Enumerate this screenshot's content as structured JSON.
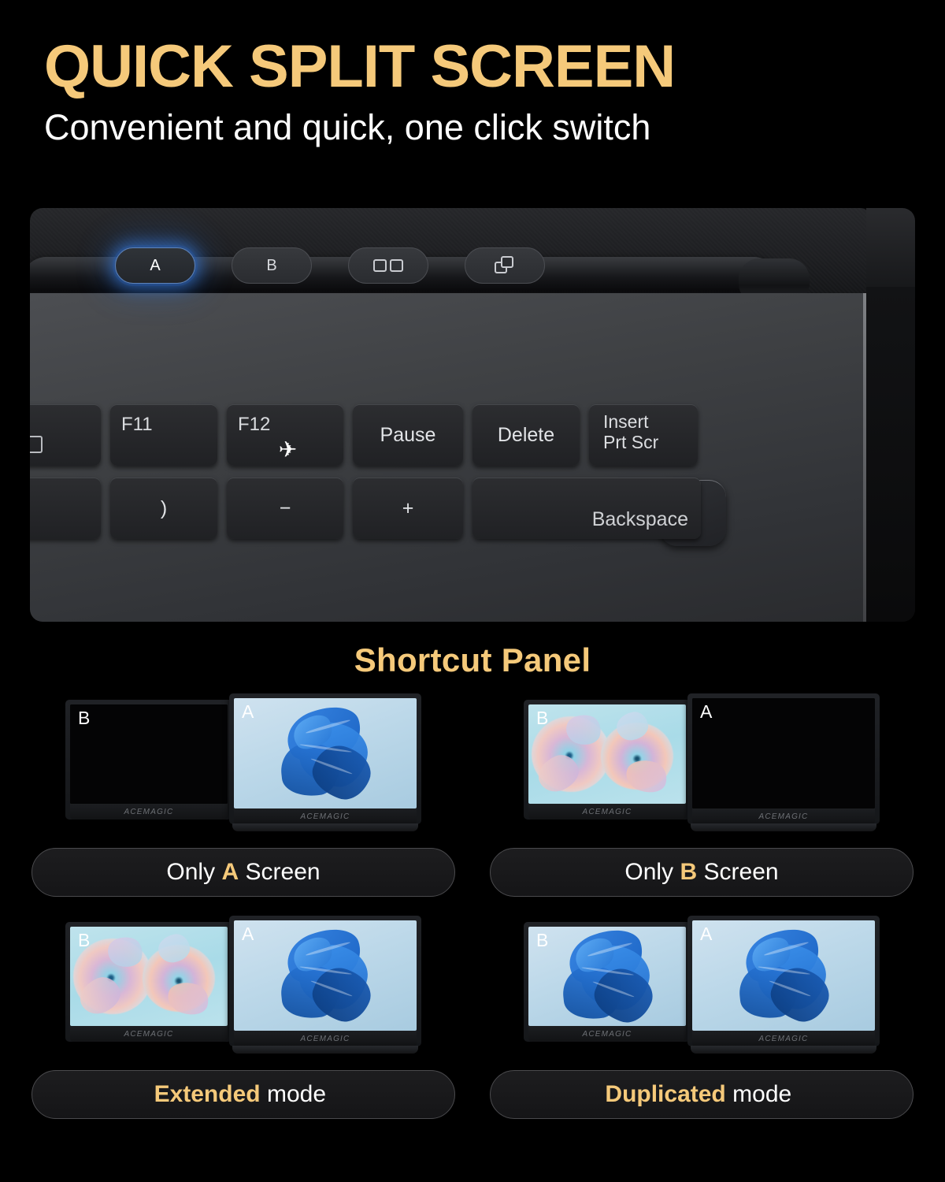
{
  "header": {
    "headline": "QUICK SPLIT SCREEN",
    "subhead": "Convenient and quick, one click switch"
  },
  "product_photo": {
    "shortcut_buttons": [
      {
        "label": "A",
        "icon": "letter-a",
        "state": "active-glow"
      },
      {
        "label": "B",
        "icon": "letter-b",
        "state": "idle"
      },
      {
        "label": "",
        "icon": "split-screen-icon",
        "state": "idle"
      },
      {
        "label": "",
        "icon": "duplicate-windows-icon",
        "state": "idle"
      }
    ],
    "power_button": "power-button",
    "keyboard_row_1": [
      {
        "label": "",
        "icon": "screen-icon"
      },
      {
        "label": "F11"
      },
      {
        "label": "F12",
        "icon": "airplane-mode-icon"
      },
      {
        "label": "Pause"
      },
      {
        "label": "Delete"
      },
      {
        "label": "Insert",
        "label2": "Prt Scr"
      }
    ],
    "keyboard_row_2": [
      {
        "label": ")"
      },
      {
        "label": "−"
      },
      {
        "label": "+"
      },
      {
        "label": "Backspace"
      }
    ]
  },
  "shortcut_panel": {
    "title": "Shortcut Panel",
    "accent_color": "#F5C97A",
    "brand": "ACEMAGIC",
    "modes": [
      {
        "name": "only-a-screen",
        "label_prefix": "Only",
        "label_accent": "A",
        "label_suffix": "Screen",
        "left_screen": {
          "letter": "B",
          "wallpaper": "off"
        },
        "right_screen": {
          "letter": "A",
          "wallpaper": "windows-bloom"
        }
      },
      {
        "name": "only-b-screen",
        "label_prefix": "Only",
        "label_accent": "B",
        "label_suffix": "Screen",
        "left_screen": {
          "letter": "B",
          "wallpaper": "flowers"
        },
        "right_screen": {
          "letter": "A",
          "wallpaper": "off"
        }
      },
      {
        "name": "extended-mode",
        "label_prefix": "",
        "label_accent": "Extended",
        "label_suffix": "mode",
        "left_screen": {
          "letter": "B",
          "wallpaper": "flowers"
        },
        "right_screen": {
          "letter": "A",
          "wallpaper": "windows-bloom"
        }
      },
      {
        "name": "duplicated-mode",
        "label_prefix": "",
        "label_accent": "Duplicated",
        "label_suffix": "mode",
        "left_screen": {
          "letter": "B",
          "wallpaper": "windows-bloom"
        },
        "right_screen": {
          "letter": "A",
          "wallpaper": "windows-bloom"
        }
      }
    ]
  }
}
